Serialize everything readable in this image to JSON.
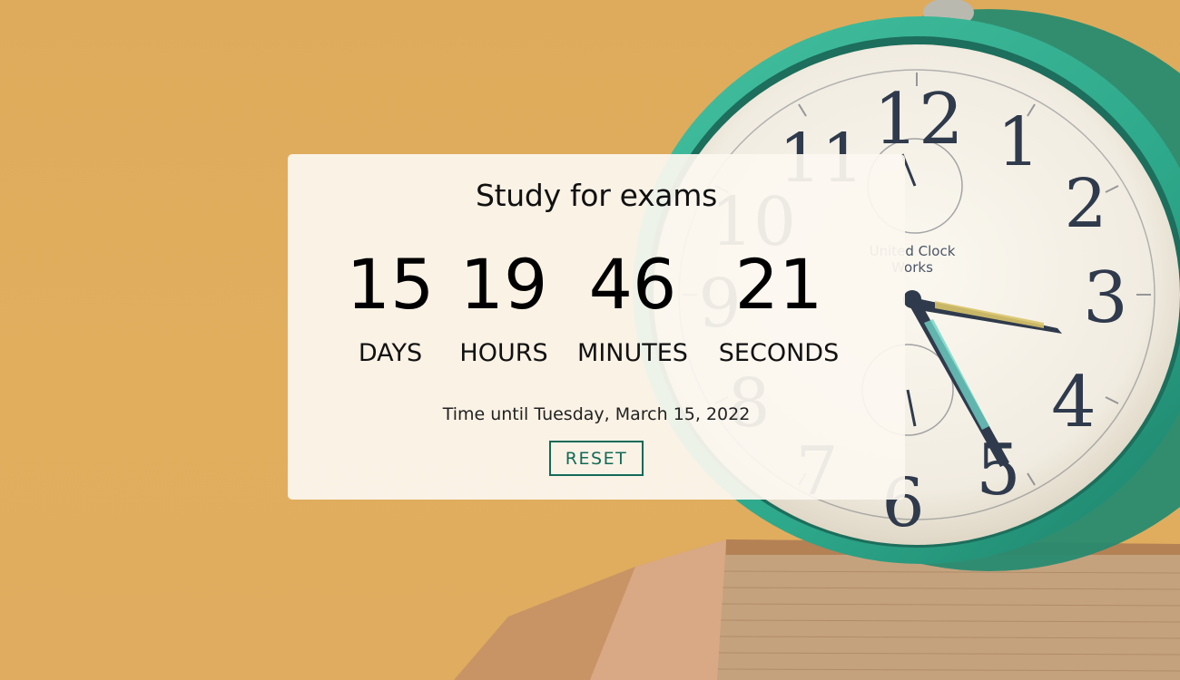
{
  "countdown": {
    "title": "Study for exams",
    "units": [
      {
        "value": "15",
        "label": "DAYS"
      },
      {
        "value": "19",
        "label": "HOURS"
      },
      {
        "value": "46",
        "label": "MINUTES"
      },
      {
        "value": "21",
        "label": "SECONDS"
      }
    ],
    "until_text": "Time until Tuesday, March 15, 2022",
    "reset_label": "RESET"
  },
  "background": {
    "clock_brand": "United Clock Works",
    "clock_numerals": [
      "12",
      "1",
      "2",
      "3",
      "4",
      "5",
      "6",
      "7",
      "8",
      "9",
      "10",
      "11"
    ],
    "colors": {
      "backdrop": "#deab5c",
      "clock_rim": "#2ea88a",
      "accent": "#136a58"
    }
  }
}
